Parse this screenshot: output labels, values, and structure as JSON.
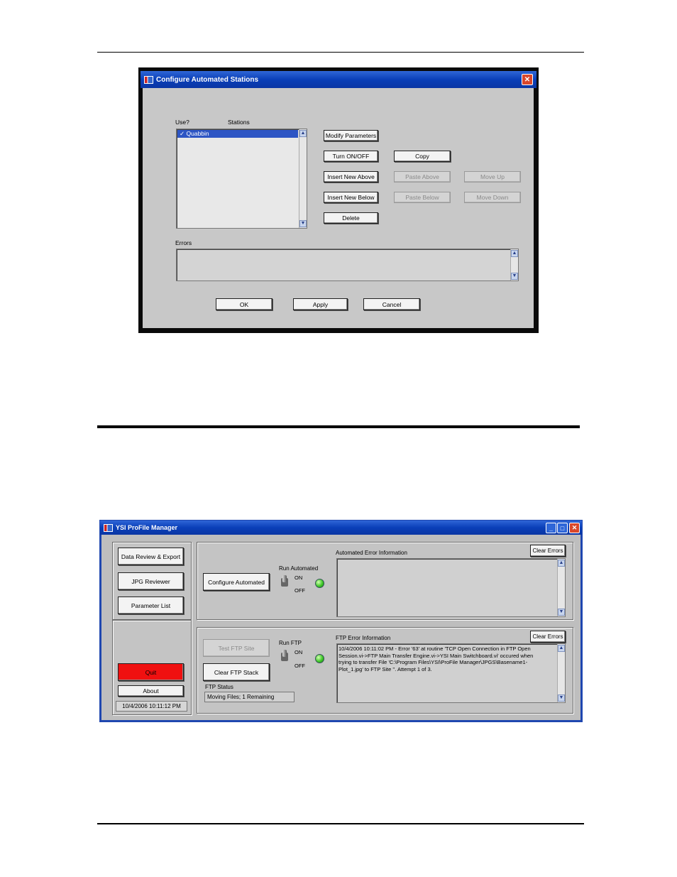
{
  "dialog": {
    "title": "Configure Automated Stations",
    "use_label": "Use?",
    "stations_label": "Stations",
    "stations": [
      {
        "check": "✓",
        "name": "Quabbin"
      }
    ],
    "buttons": {
      "modify_parameters": "Modify Parameters",
      "turn_on_off": "Turn ON/OFF",
      "copy": "Copy",
      "insert_new_above": "Insert New Above",
      "paste_above": "Paste Above",
      "move_up": "Move Up",
      "insert_new_below": "Insert New Below",
      "paste_below": "Paste Below",
      "move_down": "Move Down",
      "delete": "Delete",
      "ok": "OK",
      "apply": "Apply",
      "cancel": "Cancel"
    },
    "errors_label": "Errors",
    "close_glyph": "✕"
  },
  "manager": {
    "title": "YSI ProFile Manager",
    "window_buttons": {
      "minimize": "_",
      "maximize": "□",
      "close": "✕"
    },
    "nav": {
      "data_review": "Data Review & Export",
      "jpg_reviewer": "JPG Reviewer",
      "parameter_list": "Parameter List",
      "quit": "Quit",
      "about": "About",
      "datetime": "10/4/2006 10:11:12 PM"
    },
    "automated": {
      "configure_button": "Configure Automated",
      "run_label": "Run Automated",
      "on": "ON",
      "off": "OFF",
      "error_label": "Automated Error Information",
      "clear_errors": "Clear Errors",
      "error_text": ""
    },
    "ftp": {
      "test_button": "Test FTP Site",
      "clear_stack_button": "Clear FTP Stack",
      "run_label": "Run FTP",
      "on": "ON",
      "off": "OFF",
      "status_label": "FTP Status",
      "status_value": "Moving Files; 1 Remaining",
      "error_label": "FTP Error Information",
      "clear_errors": "Clear Errors",
      "error_lines": [
        "10/4/2006 10:11:02 PM - Error '63' at routine 'TCP Open Connection in FTP Open",
        "Session.vi->FTP Main Transfer Engine.vi->YSI Main Switchboard.vi' occured  when",
        "trying to transfer File 'C:\\Program Files\\YSI\\ProFile Manager\\JPGS\\Basename1-",
        "Plot_1.jpg' to FTP Site ''.  Attempt 1 of 3."
      ]
    }
  }
}
